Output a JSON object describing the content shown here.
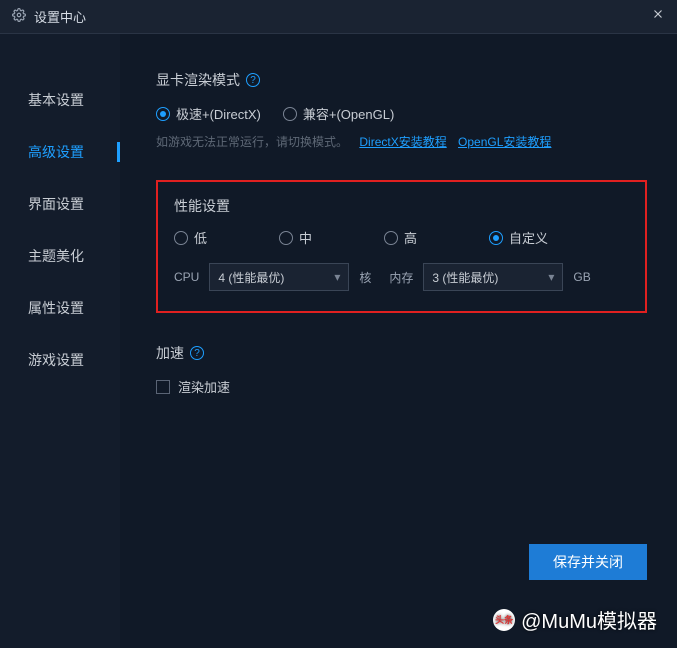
{
  "titlebar": {
    "title": "设置中心"
  },
  "sidebar": {
    "items": [
      {
        "label": "基本设置"
      },
      {
        "label": "高级设置"
      },
      {
        "label": "界面设置"
      },
      {
        "label": "主题美化"
      },
      {
        "label": "属性设置"
      },
      {
        "label": "游戏设置"
      }
    ]
  },
  "render": {
    "title": "显卡渲染模式",
    "options": [
      {
        "label": "极速+(DirectX)"
      },
      {
        "label": "兼容+(OpenGL)"
      }
    ],
    "hint": "如游戏无法正常运行，请切换模式。",
    "link1": "DirectX安装教程",
    "link2": "OpenGL安装教程"
  },
  "perf": {
    "title": "性能设置",
    "options": [
      {
        "label": "低"
      },
      {
        "label": "中"
      },
      {
        "label": "高"
      },
      {
        "label": "自定义"
      }
    ],
    "cpu_label": "CPU",
    "cpu_value": "4 (性能最优)",
    "cpu_unit": "核",
    "mem_label": "内存",
    "mem_value": "3 (性能最优)",
    "mem_unit": "GB"
  },
  "accel": {
    "title": "加速",
    "checkbox_label": "渲染加速"
  },
  "footer": {
    "save": "保存并关闭"
  },
  "watermark": "@MuMu模拟器",
  "watermark_prefix": "头条"
}
